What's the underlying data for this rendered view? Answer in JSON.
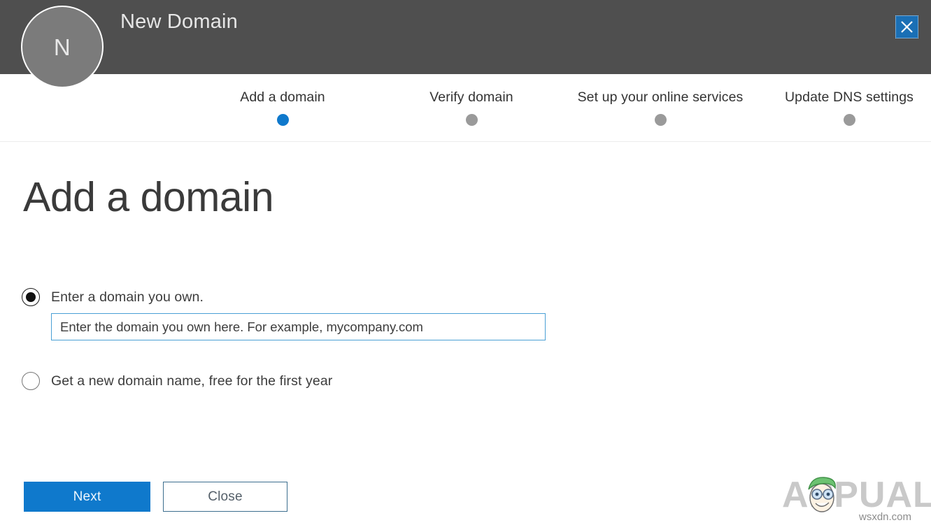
{
  "header": {
    "title": "New Domain",
    "avatar_letter": "N",
    "close_label": "Close",
    "close_icon": "close-x-icon",
    "background_color": "#4f4f4f",
    "close_button_color": "#1a6fb5"
  },
  "steps": {
    "items": [
      {
        "label": "Add a domain",
        "state": "active"
      },
      {
        "label": "Verify domain",
        "state": "inactive"
      },
      {
        "label": "Set up your online services",
        "state": "inactive"
      },
      {
        "label": "Update DNS settings",
        "state": "inactive"
      }
    ],
    "active_color": "#0f79cc",
    "inactive_color": "#9a9a9a"
  },
  "main": {
    "page_title": "Add a domain",
    "options": [
      {
        "label": "Enter a domain you own.",
        "selected": true
      },
      {
        "label": "Get a new domain name, free for the first year",
        "selected": false
      }
    ],
    "domain_input": {
      "value": "",
      "placeholder": "Enter the domain you own here. For example, mycompany.com",
      "border_color": "#4aa0d5"
    }
  },
  "footer": {
    "next_label": "Next",
    "close_label": "Close",
    "primary_color": "#0f79cc",
    "secondary_border_color": "#3c6e8e"
  },
  "watermark": {
    "brand": "APPUALS",
    "site": "wsxdn.com"
  }
}
